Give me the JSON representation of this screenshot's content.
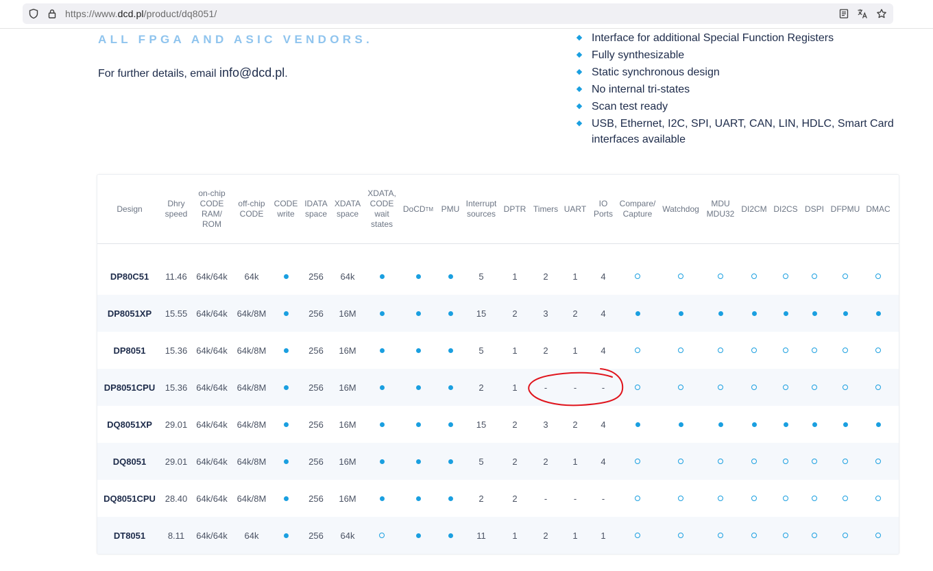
{
  "browser": {
    "url_host_prefix": "https://www.",
    "url_host": "dcd.pl",
    "url_path": "/product/dq8051/"
  },
  "tagline": "ALL FPGA AND ASIC VENDORS.",
  "details_text": "For further details, email ",
  "details_email": "info@dcd.pl",
  "details_suffix": ".",
  "features": [
    "Interface for additional Special Function Registers",
    "Fully synthesizable",
    "Static synchronous design",
    "No internal tri-states",
    "Scan test ready",
    "USB, Ethernet, I2C, SPI, UART, CAN, LIN, HDLC, Smart Card interfaces available"
  ],
  "table": {
    "columns": [
      {
        "label": "Design"
      },
      {
        "label": "Dhry\nspeed"
      },
      {
        "label": "on-chip\nCODE\nRAM/\nROM"
      },
      {
        "label": "off-chip\nCODE"
      },
      {
        "label": "CODE\nwrite"
      },
      {
        "label": "IDATA\nspace"
      },
      {
        "label": "XDATA\nspace"
      },
      {
        "label": "XDATA,\nCODE\nwait\nstates"
      },
      {
        "label": "DoCD",
        "sup": "TM"
      },
      {
        "label": "PMU"
      },
      {
        "label": "Interrupt\nsources"
      },
      {
        "label": "DPTR"
      },
      {
        "label": "Timers"
      },
      {
        "label": "UART"
      },
      {
        "label": "IO\nPorts"
      },
      {
        "label": "Compare/\nCapture"
      },
      {
        "label": "Watchdog"
      },
      {
        "label": "MDU\nMDU32"
      },
      {
        "label": "DI2CM"
      },
      {
        "label": "DI2CS"
      },
      {
        "label": "DSPI"
      },
      {
        "label": "DFPMU"
      },
      {
        "label": "DMAC"
      }
    ],
    "rows": [
      {
        "design": "DP80C51",
        "values": [
          "11.46",
          "64k/64k",
          "64k",
          "dot",
          "256",
          "64k",
          "dot",
          "dot",
          "dot",
          "5",
          "1",
          "2",
          "1",
          "4",
          "ring",
          "ring",
          "ring",
          "ring",
          "ring",
          "ring",
          "ring",
          "ring"
        ]
      },
      {
        "design": "DP8051XP",
        "values": [
          "15.55",
          "64k/64k",
          "64k/8M",
          "dot",
          "256",
          "16M",
          "dot",
          "dot",
          "dot",
          "15",
          "2",
          "3",
          "2",
          "4",
          "dot",
          "dot",
          "dot",
          "dot",
          "dot",
          "dot",
          "dot",
          "dot"
        ]
      },
      {
        "design": "DP8051",
        "values": [
          "15.36",
          "64k/64k",
          "64k/8M",
          "dot",
          "256",
          "16M",
          "dot",
          "dot",
          "dot",
          "5",
          "1",
          "2",
          "1",
          "4",
          "ring",
          "ring",
          "ring",
          "ring",
          "ring",
          "ring",
          "ring",
          "ring"
        ]
      },
      {
        "design": "DP8051CPU",
        "values": [
          "15.36",
          "64k/64k",
          "64k/8M",
          "dot",
          "256",
          "16M",
          "dot",
          "dot",
          "dot",
          "2",
          "1",
          "-",
          "-",
          "-",
          "ring",
          "ring",
          "ring",
          "ring",
          "ring",
          "ring",
          "ring",
          "ring"
        ]
      },
      {
        "design": "DQ8051XP",
        "values": [
          "29.01",
          "64k/64k",
          "64k/8M",
          "dot",
          "256",
          "16M",
          "dot",
          "dot",
          "dot",
          "15",
          "2",
          "3",
          "2",
          "4",
          "dot",
          "dot",
          "dot",
          "dot",
          "dot",
          "dot",
          "dot",
          "dot"
        ]
      },
      {
        "design": "DQ8051",
        "values": [
          "29.01",
          "64k/64k",
          "64k/8M",
          "dot",
          "256",
          "16M",
          "dot",
          "dot",
          "dot",
          "5",
          "2",
          "2",
          "1",
          "4",
          "ring",
          "ring",
          "ring",
          "ring",
          "ring",
          "ring",
          "ring",
          "ring"
        ]
      },
      {
        "design": "DQ8051CPU",
        "values": [
          "28.40",
          "64k/64k",
          "64k/8M",
          "dot",
          "256",
          "16M",
          "dot",
          "dot",
          "dot",
          "2",
          "2",
          "-",
          "-",
          "-",
          "ring",
          "ring",
          "ring",
          "ring",
          "ring",
          "ring",
          "ring",
          "ring"
        ]
      },
      {
        "design": "DT8051",
        "values": [
          "8.11",
          "64k/64k",
          "64k",
          "dot",
          "256",
          "64k",
          "ring",
          "dot",
          "dot",
          "11",
          "1",
          "2",
          "1",
          "1",
          "ring",
          "ring",
          "ring",
          "ring",
          "ring",
          "ring",
          "ring",
          "ring"
        ]
      }
    ]
  },
  "colors": {
    "accent": "#1a9fe0",
    "tagline": "#8fc4ee",
    "annotation": "#e0141c"
  }
}
